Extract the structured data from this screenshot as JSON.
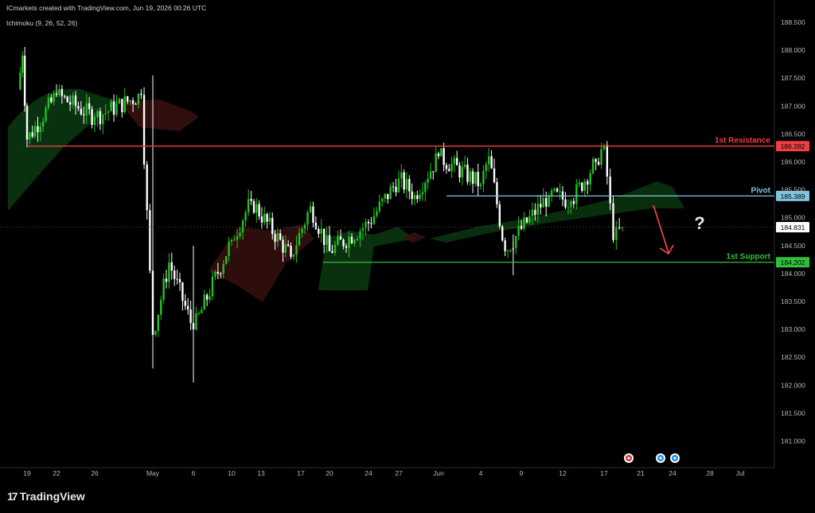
{
  "header": {
    "attribution": "ICmarkets created with TradingView.com, Jun 19, 2026 00:26 UTC",
    "indicator": "Ichimoku (9, 26, 52, 26)"
  },
  "footer": {
    "brand": "TradingView",
    "brand_mark": "17"
  },
  "colors": {
    "background": "#000000",
    "bull": "#22c31e",
    "bear": "#ffffff",
    "resistance": "#ef3e46",
    "pivot": "#7fc3dd",
    "support": "#2fbf3c",
    "arrow": "#e8433f",
    "question": "#e6e6e6"
  },
  "chart_data": {
    "type": "candlestick",
    "y_axis": {
      "min": 180.7,
      "max": 188.65,
      "ticks": [
        "188.500",
        "188.000",
        "187.500",
        "187.000",
        "186.500",
        "186.000",
        "185.500",
        "185.000",
        "184.500",
        "184.000",
        "183.500",
        "183.000",
        "182.500",
        "182.000",
        "181.500",
        "181.000"
      ]
    },
    "x_axis": {
      "ticks": [
        "19",
        "22",
        "26",
        "May",
        "6",
        "10",
        "13",
        "17",
        "20",
        "24",
        "27",
        "Jun",
        "4",
        "9",
        "12",
        "17",
        "21",
        "24",
        "28",
        "Jul"
      ]
    },
    "levels": [
      {
        "name": "1st Resistance",
        "value": 186.282,
        "label": "186.282",
        "color": "#ef3e46"
      },
      {
        "name": "Pivot",
        "value": 185.389,
        "label": "185.389",
        "color": "#7fc3dd"
      },
      {
        "name": "1st Support",
        "value": 184.202,
        "label": "184.202",
        "color": "#2fbf3c"
      }
    ],
    "last_price": {
      "value": 184.831,
      "label": "184.831"
    },
    "annotation": "?",
    "key_points": [
      {
        "x": "Apr 17",
        "close": 187.3
      },
      {
        "x": "Apr 18",
        "close": 187.9
      },
      {
        "x": "Apr 19",
        "close": 186.4
      },
      {
        "x": "Apr 22",
        "close": 187.2
      },
      {
        "x": "Apr 26",
        "close": 186.8
      },
      {
        "x": "Apr 30",
        "close": 187.2
      },
      {
        "x": "May 1",
        "close": 182.9
      },
      {
        "x": "May 3",
        "close": 184.2
      },
      {
        "x": "May 6",
        "close": 183.0
      },
      {
        "x": "May 10",
        "close": 184.6
      },
      {
        "x": "May 12",
        "close": 185.3
      },
      {
        "x": "May 16",
        "close": 184.3
      },
      {
        "x": "May 18",
        "close": 185.2
      },
      {
        "x": "May 20",
        "close": 184.4
      },
      {
        "x": "May 24",
        "close": 184.9
      },
      {
        "x": "May 27",
        "close": 185.7
      },
      {
        "x": "May 29",
        "close": 185.4
      },
      {
        "x": "Jun 1",
        "close": 186.1
      },
      {
        "x": "Jun 4",
        "close": 185.6
      },
      {
        "x": "Jun 5",
        "close": 186.1
      },
      {
        "x": "Jun 7",
        "close": 184.4
      },
      {
        "x": "Jun 9",
        "close": 184.8
      },
      {
        "x": "Jun 11",
        "close": 185.4
      },
      {
        "x": "Jun 13",
        "close": 185.3
      },
      {
        "x": "Jun 16",
        "close": 186.0
      },
      {
        "x": "Jun 17",
        "close": 186.3
      },
      {
        "x": "Jun 18",
        "close": 184.6
      },
      {
        "x": "Jun 19",
        "close": 184.831
      }
    ]
  }
}
